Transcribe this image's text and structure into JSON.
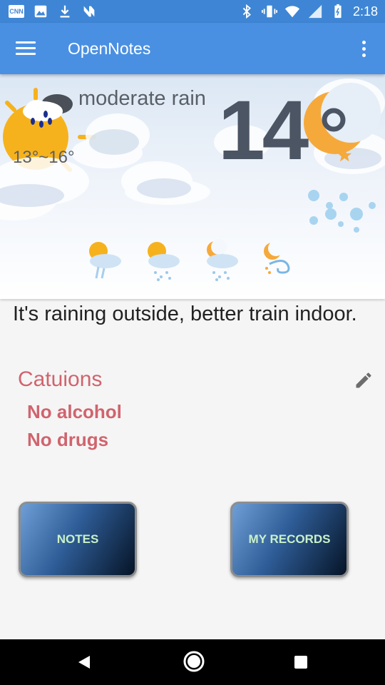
{
  "status_bar": {
    "time": "2:18",
    "cnn_label": "CNN",
    "left_icons": [
      "cnn-icon",
      "image-icon",
      "download-icon",
      "n-icon"
    ],
    "right_icons": [
      "bluetooth-icon",
      "vibrate-icon",
      "wifi-icon",
      "signal-icon",
      "battery-icon"
    ]
  },
  "app_bar": {
    "title": "OpenNotes",
    "menu_icon": "hamburger-menu-icon",
    "overflow_icon": "more-vert-icon"
  },
  "weather": {
    "condition": "moderate rain",
    "range": "13°~16°",
    "temperature": "14",
    "forecast_icons": [
      "sun-rain-icon",
      "sun-snow-icon",
      "moon-snow-icon",
      "moon-wind-icon"
    ]
  },
  "advice": "It's raining outside, better train indoor.",
  "cautions": {
    "title": "Catuions",
    "items": [
      "No alcohol",
      "No drugs"
    ],
    "edit_icon": "pencil-icon"
  },
  "buttons": {
    "notes": "NOTES",
    "records": "MY RECORDS"
  },
  "colors": {
    "status_bar": "#3e86d5",
    "app_bar": "#4a90e2",
    "caution": "#d0646e",
    "button_text": "#c9f1c9"
  }
}
